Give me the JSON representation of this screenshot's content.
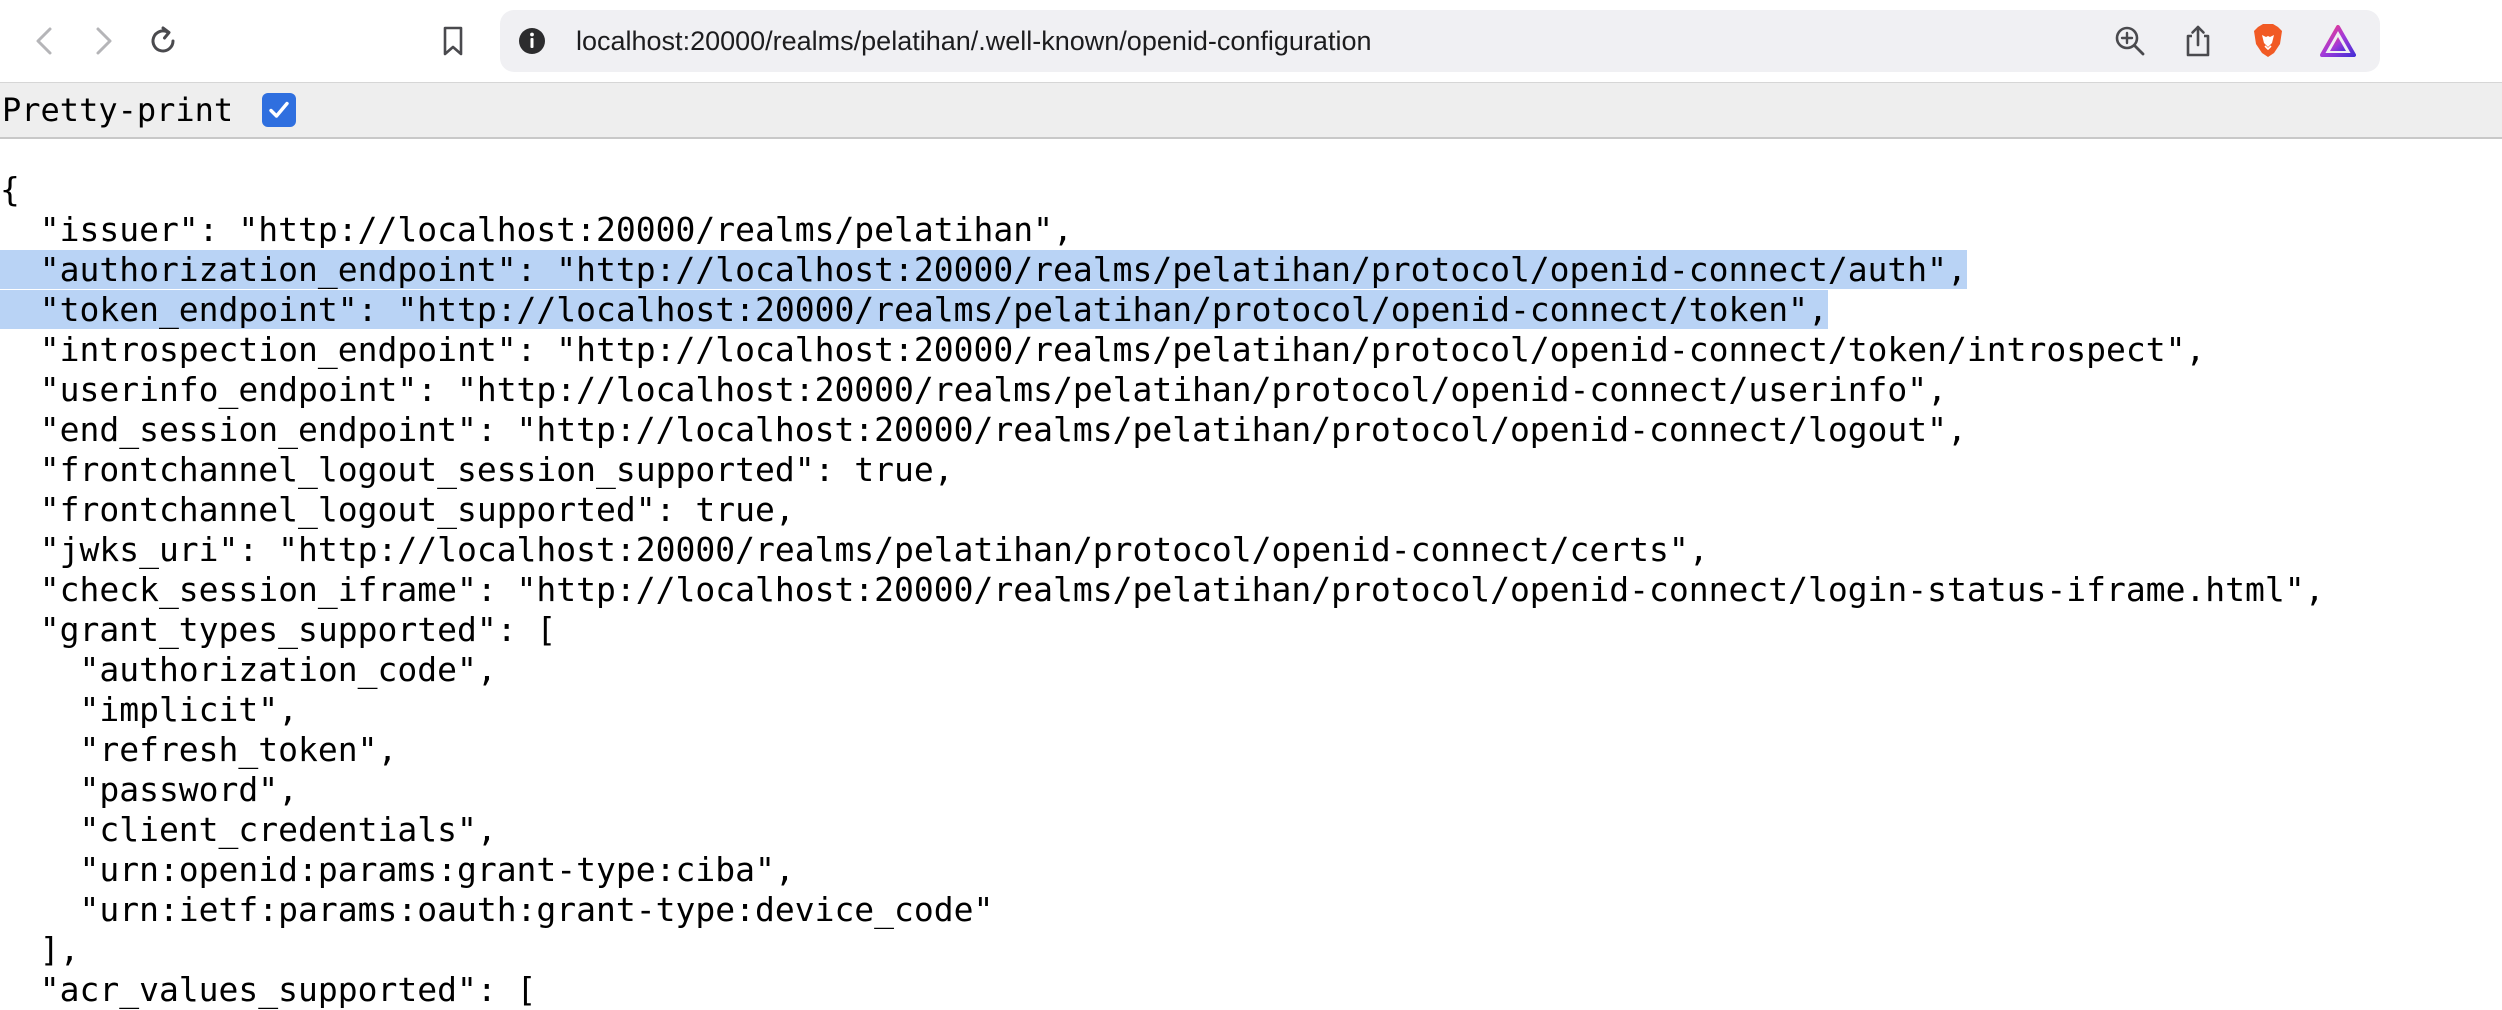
{
  "browser": {
    "url": "localhost:20000/realms/pelatihan/.well-known/openid-configuration",
    "icons": [
      "back-arrow-icon",
      "forward-arrow-icon",
      "reload-icon",
      "bookmark-icon",
      "info-icon",
      "zoom-icon",
      "share-icon",
      "brave-lion-icon",
      "brave-rewards-triangle-icon"
    ]
  },
  "pretty_print": {
    "label": "Pretty-print",
    "checked": true
  },
  "json_lines": [
    {
      "text": "{"
    },
    {
      "text": "  \"issuer\": \"http://localhost:20000/realms/pelatihan\","
    },
    {
      "text": "  \"authorization_endpoint\": \"http://localhost:20000/realms/pelatihan/protocol/openid-connect/auth\",",
      "selected": true
    },
    {
      "text": "  \"token_endpoint\": \"http://localhost:20000/realms/pelatihan/protocol/openid-connect/token\",",
      "selected": true
    },
    {
      "text": "  \"introspection_endpoint\": \"http://localhost:20000/realms/pelatihan/protocol/openid-connect/token/introspect\","
    },
    {
      "text": "  \"userinfo_endpoint\": \"http://localhost:20000/realms/pelatihan/protocol/openid-connect/userinfo\","
    },
    {
      "text": "  \"end_session_endpoint\": \"http://localhost:20000/realms/pelatihan/protocol/openid-connect/logout\","
    },
    {
      "text": "  \"frontchannel_logout_session_supported\": true,"
    },
    {
      "text": "  \"frontchannel_logout_supported\": true,"
    },
    {
      "text": "  \"jwks_uri\": \"http://localhost:20000/realms/pelatihan/protocol/openid-connect/certs\","
    },
    {
      "text": "  \"check_session_iframe\": \"http://localhost:20000/realms/pelatihan/protocol/openid-connect/login-status-iframe.html\","
    },
    {
      "text": "  \"grant_types_supported\": ["
    },
    {
      "text": "    \"authorization_code\","
    },
    {
      "text": "    \"implicit\","
    },
    {
      "text": "    \"refresh_token\","
    },
    {
      "text": "    \"password\","
    },
    {
      "text": "    \"client_credentials\","
    },
    {
      "text": "    \"urn:openid:params:grant-type:ciba\","
    },
    {
      "text": "    \"urn:ietf:params:oauth:grant-type:device_code\""
    },
    {
      "text": "  ],"
    },
    {
      "text": "  \"acr_values_supported\": ["
    }
  ]
}
